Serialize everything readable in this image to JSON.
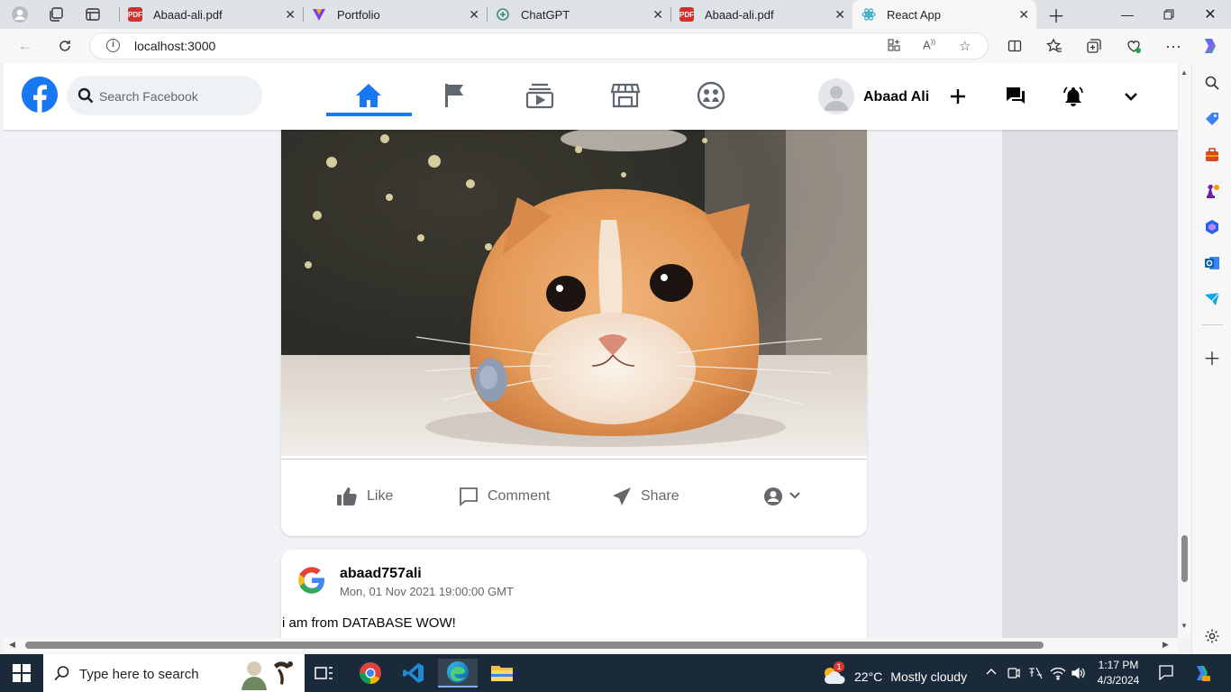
{
  "browser": {
    "tabs": [
      {
        "title": "Abaad-ali.pdf",
        "icon": "pdf-icon"
      },
      {
        "title": "Portfolio",
        "icon": "portfolio-icon"
      },
      {
        "title": "ChatGPT",
        "icon": "chatgpt-icon"
      },
      {
        "title": "Abaad-ali.pdf",
        "icon": "pdf-icon"
      },
      {
        "title": "React App",
        "icon": "react-icon",
        "active": true
      }
    ],
    "url": "localhost:3000"
  },
  "header": {
    "logo": "f",
    "search_placeholder": "Search Facebook",
    "user_name": "Abaad Ali",
    "nav": [
      "home-icon",
      "flag-icon",
      "watch-icon",
      "marketplace-icon",
      "groups-icon"
    ],
    "accent": "#1877f2"
  },
  "post": {
    "image_alt": "cat",
    "actions": {
      "like": "Like",
      "comment": "Comment",
      "share": "Share"
    }
  },
  "post2": {
    "author": "abaad757ali",
    "date": "Mon, 01 Nov 2021 19:00:00 GMT",
    "text": "i am from DATABASE WOW!"
  },
  "taskbar": {
    "search_placeholder": "Type here to search",
    "weather_temp": "22°C",
    "weather_desc": "Mostly cloudy",
    "weather_badge": "1",
    "time": "1:17 PM",
    "date": "4/3/2024"
  }
}
